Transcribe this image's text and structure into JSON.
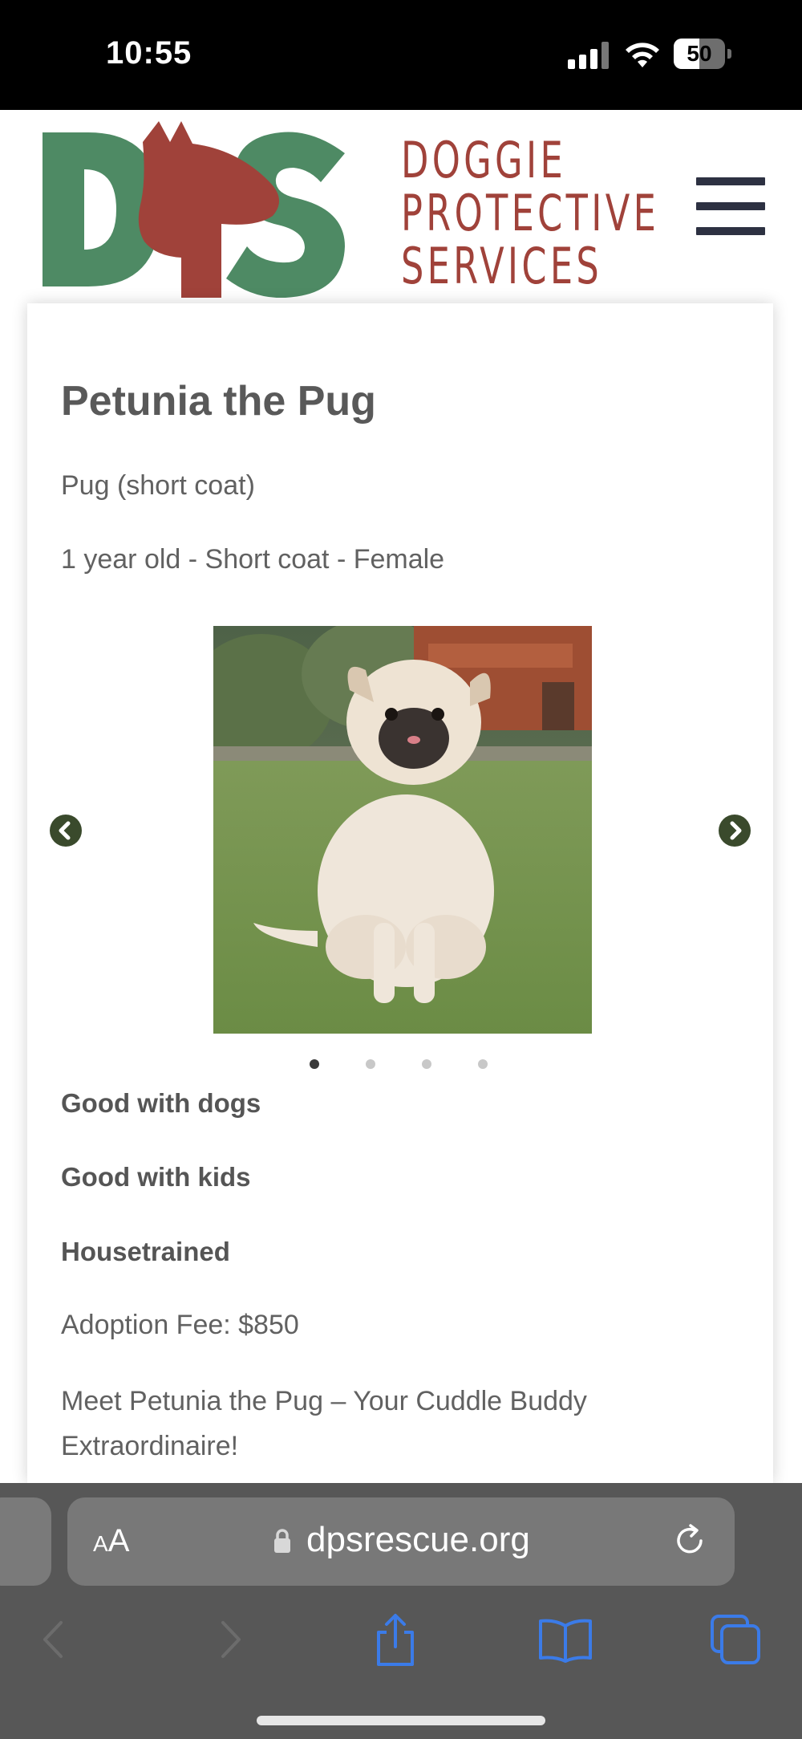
{
  "status_bar": {
    "time": "10:55",
    "battery_level": "50",
    "battery_fraction": 0.5
  },
  "header": {
    "logo_letters": "DPS",
    "logo_lines": [
      "DOGGIE",
      "PROTECTIVE",
      "SERVICES"
    ],
    "logo_colors": {
      "green": "#4e8a64",
      "red": "#a0423a"
    },
    "menu_icon": "hamburger-icon"
  },
  "pet": {
    "name": "Petunia the Pug",
    "breed": "Pug (short coat)",
    "details": "1 year old - Short coat - Female",
    "traits": [
      "Good with dogs",
      "Good with kids",
      "Housetrained"
    ],
    "adoption_fee": "Adoption Fee: $850",
    "description": "Meet Petunia the Pug – Your Cuddle Buddy Extraordinaire!"
  },
  "carousel": {
    "slide_count": 4,
    "active_slide": 1,
    "prev_icon": "chevron-left-circle-icon",
    "next_icon": "chevron-right-circle-icon"
  },
  "browser": {
    "text_size_label_small": "A",
    "text_size_label_large": "A",
    "domain": "dpsrescue.org",
    "icons": [
      "lock-icon",
      "reload-icon",
      "back-icon",
      "forward-icon",
      "share-icon",
      "bookmarks-icon",
      "tabs-icon"
    ]
  }
}
